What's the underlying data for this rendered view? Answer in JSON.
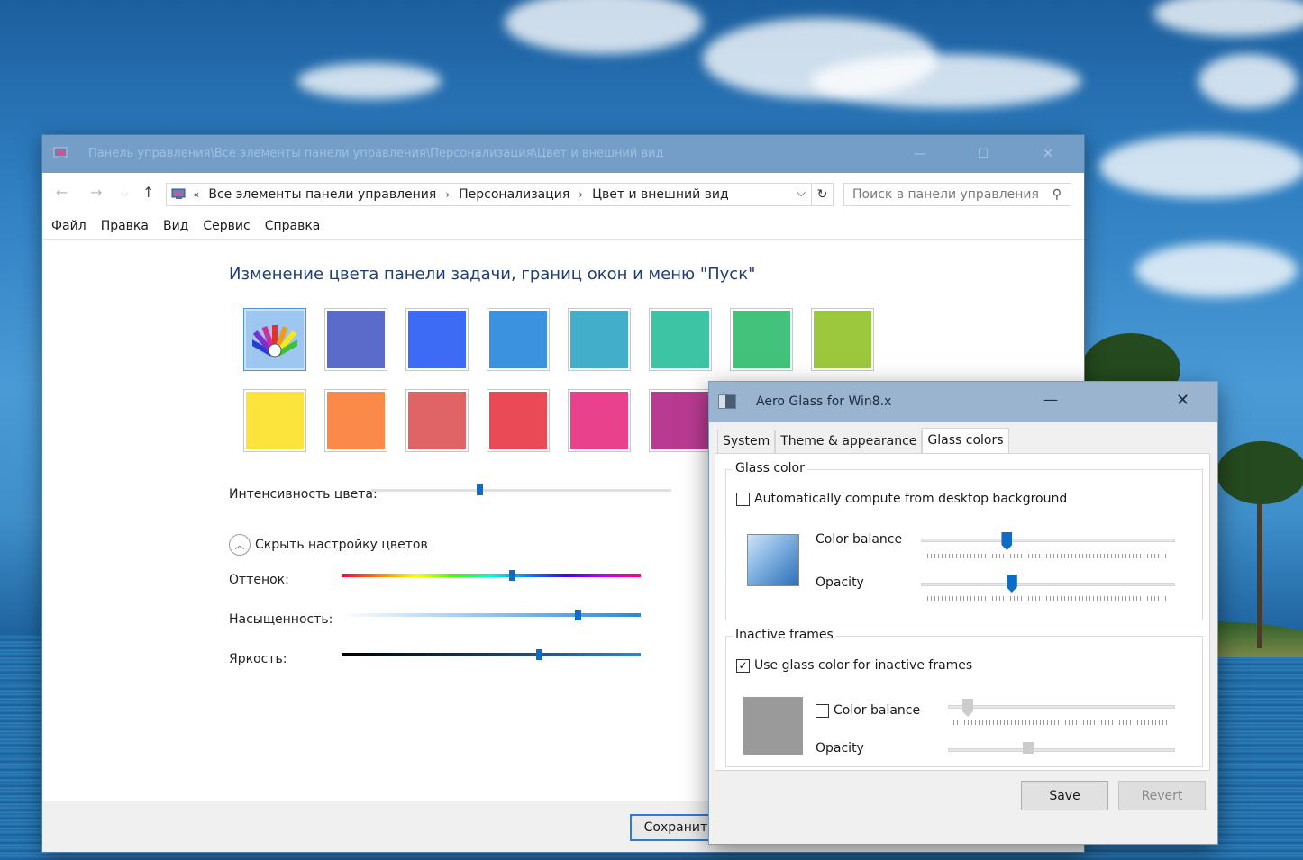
{
  "control_panel": {
    "title": "Панель управления\\Все элементы панели управления\\Персонализация\\Цвет и внешний вид",
    "breadcrumb_prefix": "«",
    "breadcrumbs": [
      "Все элементы панели управления",
      "Персонализация",
      "Цвет и внешний вид"
    ],
    "search_placeholder": "Поиск в панели управления",
    "menu": [
      "Файл",
      "Правка",
      "Вид",
      "Сервис",
      "Справка"
    ],
    "heading": "Изменение цвета панели задачи, границ окон и меню \"Пуск\"",
    "swatch_colors": [
      "#5b6bc9",
      "#3d6bf5",
      "#3b93e0",
      "#42aec9",
      "#3cc4a4",
      "#42c27a",
      "#9bc83d",
      "#fde43c",
      "#fb8a4a",
      "#e06466",
      "#ea4a55",
      "#ea418c",
      "#b93b91"
    ],
    "intensity_label": "Интенсивность цвета:",
    "intensity_value": 0.36,
    "collapse_label": "Скрыть настройку цветов",
    "hue_label": "Оттенок:",
    "hue_value": 0.57,
    "saturation_label": "Насыщенность:",
    "saturation_value": 0.79,
    "brightness_label": "Яркость:",
    "brightness_value": 0.66,
    "save_label": "Сохранить"
  },
  "aero_glass": {
    "title": "Aero Glass for Win8.x",
    "tabs": [
      "System",
      "Theme & appearance",
      "Glass colors"
    ],
    "active_tab": "Glass colors",
    "glass_color": {
      "group_title": "Glass color",
      "auto_label": "Automatically compute from desktop background",
      "auto_checked": false,
      "balance_label": "Color balance",
      "balance_value": 0.33,
      "opacity_label": "Opacity",
      "opacity_value": 0.35
    },
    "inactive": {
      "group_title": "Inactive frames",
      "use_label": "Use glass color for inactive frames",
      "use_checked": true,
      "balance_label": "Color balance",
      "balance_checked": false,
      "opacity_label": "Opacity"
    },
    "save_label": "Save",
    "revert_label": "Revert"
  }
}
